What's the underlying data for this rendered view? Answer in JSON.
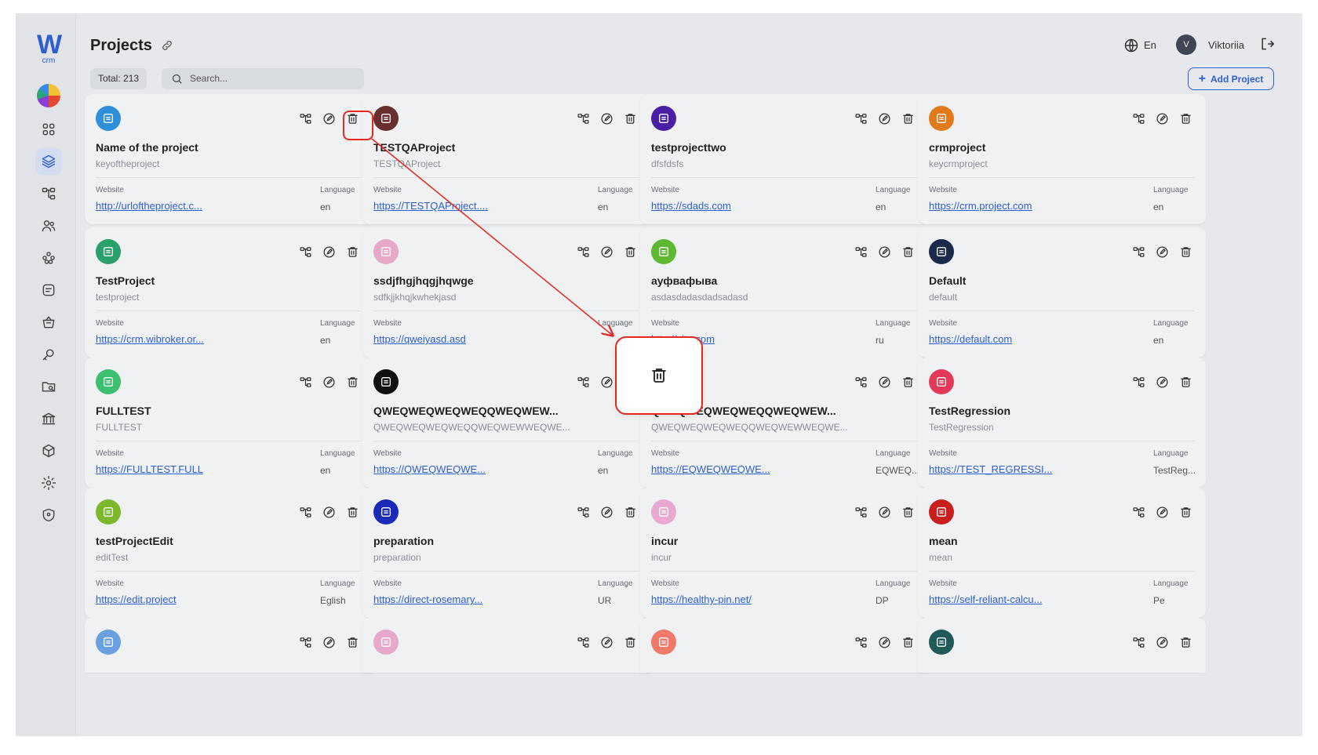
{
  "app": {
    "logo_text": "W",
    "logo_sub": "crm"
  },
  "sidebar": {
    "items": [
      {
        "icon": "dashboard-grid-icon",
        "active": false
      },
      {
        "icon": "projects-stack-icon",
        "active": true
      },
      {
        "icon": "structure-tree-icon",
        "active": false
      },
      {
        "icon": "users-icon",
        "active": false
      },
      {
        "icon": "teams-icon",
        "active": false
      },
      {
        "icon": "tasks-icon",
        "active": false
      },
      {
        "icon": "basket-icon",
        "active": false
      },
      {
        "icon": "keys-icon",
        "active": false
      },
      {
        "icon": "folder-search-icon",
        "active": false
      },
      {
        "icon": "bank-icon",
        "active": false
      },
      {
        "icon": "box-icon",
        "active": false
      },
      {
        "icon": "settings-icon",
        "active": false
      },
      {
        "icon": "shield-icon",
        "active": false
      }
    ]
  },
  "header": {
    "title": "Projects",
    "language": "En",
    "user_initial": "V",
    "user_name": "Viktoriia"
  },
  "toolbar": {
    "total": "Total: 213",
    "search_placeholder": "Search...",
    "add_label": "Add Project"
  },
  "labels": {
    "website": "Website",
    "language": "Language"
  },
  "projects": [
    {
      "name": "Name of the project",
      "key": "keyoftheproject",
      "url": "http://urloftheproject.c...",
      "lang": "en",
      "color": "#2f8fd8"
    },
    {
      "name": "TESTQAProject",
      "key": "TESTQAProject",
      "url": "https://TESTQAProject....",
      "lang": "en",
      "color": "#6a2e2e"
    },
    {
      "name": "testprojecttwo",
      "key": "dfsfdsfs",
      "url": "https://sdads.com",
      "lang": "en",
      "color": "#4a1fa6"
    },
    {
      "name": "crmproject",
      "key": "keycrmproject",
      "url": "https://crm.project.com",
      "lang": "en",
      "color": "#e07a1c"
    },
    {
      "name": "TestProject",
      "key": "testproject",
      "url": "https://crm.wibroker.or...",
      "lang": "en",
      "color": "#2aa06a"
    },
    {
      "name": "ssdjfhgjhqgjhqwge",
      "key": "sdfkjjkhqjkwhekjasd",
      "url": "https://qweiyasd.asd",
      "lang": "",
      "color": "#e8a8c8"
    },
    {
      "name": "ауфвафыва",
      "key": "asdasdadasdadsadasd",
      "url": "http://site.com",
      "lang": "ru",
      "color": "#5fb832"
    },
    {
      "name": "Default",
      "key": "default",
      "url": "https://default.com",
      "lang": "en",
      "color": "#1a2a4a"
    },
    {
      "name": "FULLTEST",
      "key": "FULLTEST",
      "url": "https://FULLTEST.FULL",
      "lang": "en",
      "color": "#3cbf6e"
    },
    {
      "name": "QWEQWEQWEQWEQQWEQWEW...",
      "key": "QWEQWEQWEQWEQQWEQWEWWEQWE...",
      "url": "https://QWEQWEQWE...",
      "lang": "en",
      "color": "#111111"
    },
    {
      "name": "QWEQWEQWEQWEQQWEQWEW...",
      "key": "QWEQWEQWEQWEQQWEQWEWWEQWE...",
      "url": "https://EQWEQWEQWE...",
      "lang": "EQWEQ...",
      "color": "#111111"
    },
    {
      "name": "TestRegression",
      "key": "TestRegression",
      "url": "https://TEST_REGRESSI...",
      "lang": "TestReg...",
      "color": "#e23a58"
    },
    {
      "name": "testProjectEdit",
      "key": "editTest",
      "url": "https://edit.project",
      "lang": "Eglish",
      "color": "#7cb82a"
    },
    {
      "name": "preparation",
      "key": "preparation",
      "url": "https://direct-rosemary...",
      "lang": "UR",
      "color": "#1c2ab8"
    },
    {
      "name": "incur",
      "key": "incur",
      "url": "https://healthy-pin.net/",
      "lang": "DP",
      "color": "#e8a8d0"
    },
    {
      "name": "mean",
      "key": "mean",
      "url": "https://self-reliant-calcu...",
      "lang": "Pe",
      "color": "#c81e1e"
    }
  ],
  "partial_projects": [
    {
      "color": "#6aa0e0"
    },
    {
      "color": "#e8a8cc"
    },
    {
      "color": "#f07a6a"
    },
    {
      "color": "#1f5a58"
    }
  ],
  "colors": {
    "accent": "#2d5fd0",
    "highlight": "#e4271f"
  }
}
